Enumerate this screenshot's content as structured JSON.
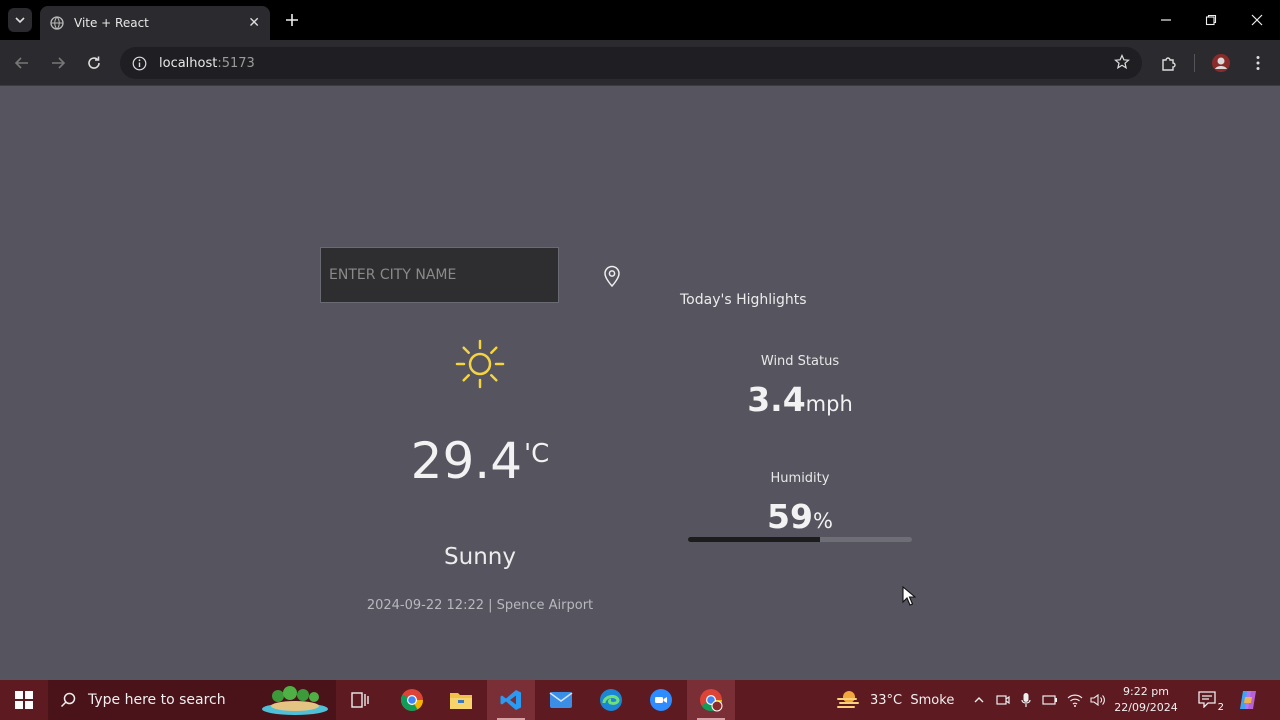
{
  "browser": {
    "tab_title": "Vite + React",
    "url_host": "localhost",
    "url_port": ":5173"
  },
  "page": {
    "search_placeholder": "ENTER CITY NAME",
    "temperature": "29.4",
    "temperature_unit": "'C",
    "condition": "Sunny",
    "datetime_location": "2024-09-22 12:22 | Spence Airport",
    "highlights_title": "Today's Highlights",
    "wind_label": "Wind Status",
    "wind_value": "3.4",
    "wind_unit": "mph",
    "humidity_label": "Humidity",
    "humidity_value": "59",
    "humidity_unit": "%",
    "humidity_fraction": 0.59
  },
  "taskbar": {
    "search_placeholder": "Type here to search",
    "weather": "33°C  Smoke",
    "time": "9:22 pm",
    "date": "22/09/2024",
    "notification_count": "2"
  },
  "icons": {
    "sun": "sun-icon",
    "location": "location-pin-icon",
    "accent_sun": "#f5d442"
  }
}
